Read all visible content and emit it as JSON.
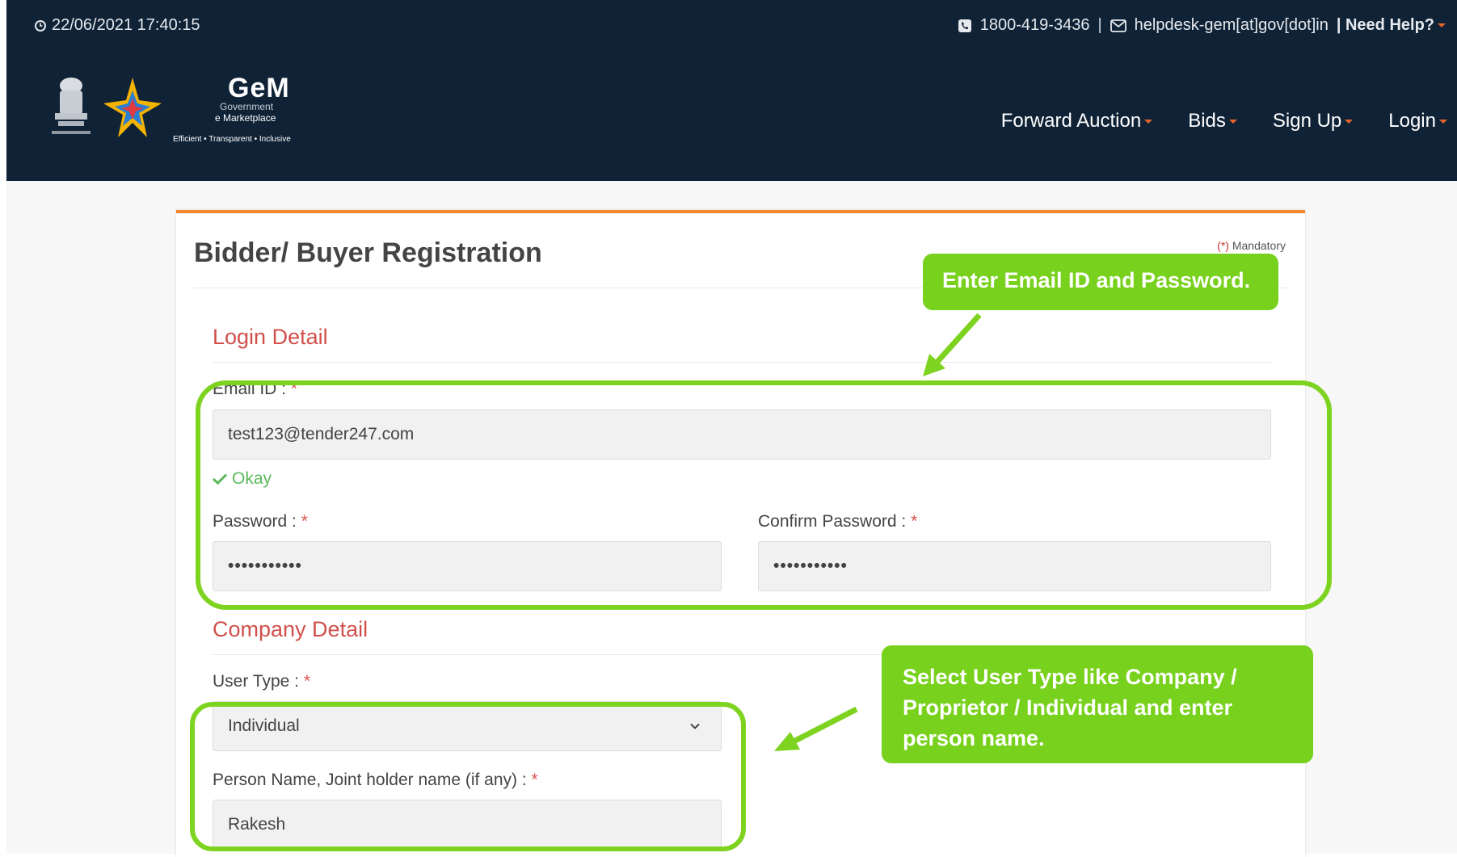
{
  "header": {
    "datetime": "22/06/2021 17:40:15",
    "phone": "1800-419-3436",
    "separator": "|",
    "email": "helpdesk-gem[at]gov[dot]in",
    "need_help": "| Need Help?",
    "logo": {
      "title": "GeM",
      "subtitle1": "Government",
      "subtitle2": "e Marketplace",
      "tagline": "Efficient • Transparent • Inclusive"
    },
    "nav": [
      {
        "label": "Forward Auction"
      },
      {
        "label": "Bids"
      },
      {
        "label": "Sign Up"
      },
      {
        "label": "Login"
      }
    ],
    "colors": {
      "background": "#0f2236",
      "caret": "#e8632a"
    }
  },
  "form": {
    "title": "Bidder/ Buyer Registration",
    "mandatory_prefix": "(*)",
    "mandatory_text": "Mandatory",
    "login_section": "Login Detail",
    "email_label": "Email ID :",
    "email_value": "test123@tender247.com",
    "email_status": "Okay",
    "password_label": "Password :",
    "password_value": "•••••••••••",
    "confirm_password_label": "Confirm Password :",
    "confirm_password_value": "•••••••••••",
    "company_section": "Company Detail",
    "user_type_label": "User Type :",
    "user_type_value": "Individual",
    "person_name_label": "Person Name, Joint holder name (if any) :",
    "person_name_value": "Rakesh",
    "required_marker": "*"
  },
  "annotations": {
    "callout1": "Enter Email ID and Password.",
    "callout2": "Select User Type like Company / Proprietor / Individual and enter person name.",
    "color": "#7ed320"
  }
}
